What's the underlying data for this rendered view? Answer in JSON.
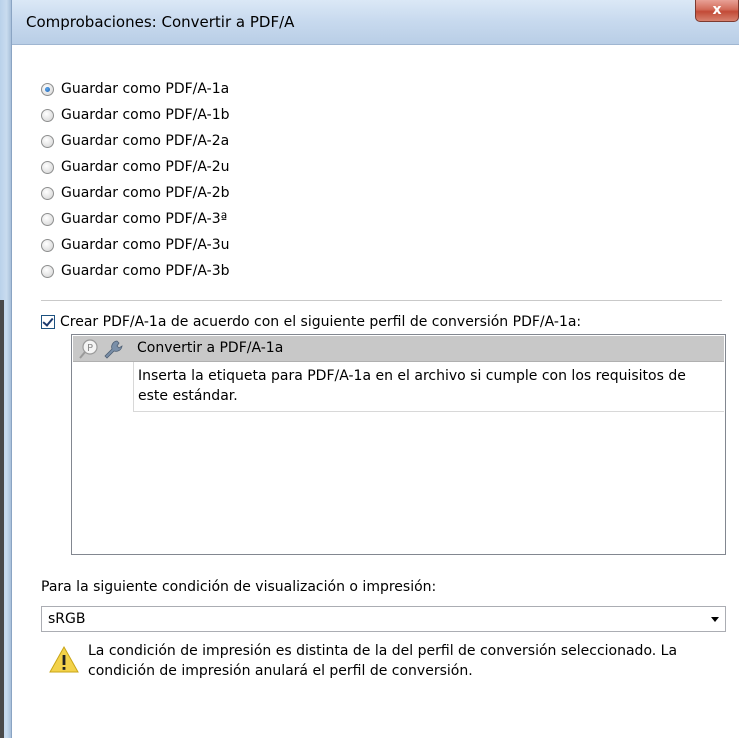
{
  "window": {
    "title": "Comprobaciones: Convertir a PDF/A",
    "close_label": "x"
  },
  "options": [
    {
      "label": "Guardar como PDF/A-1a",
      "checked": true
    },
    {
      "label": "Guardar como PDF/A-1b",
      "checked": false
    },
    {
      "label": "Guardar como PDF/A-2a",
      "checked": false
    },
    {
      "label": "Guardar como PDF/A-2u",
      "checked": false
    },
    {
      "label": "Guardar como PDF/A-2b",
      "checked": false
    },
    {
      "label": "Guardar como PDF/A-3ª",
      "checked": false
    },
    {
      "label": "Guardar como PDF/A-3u",
      "checked": false
    },
    {
      "label": "Guardar como PDF/A-3b",
      "checked": false
    }
  ],
  "create_checkbox": {
    "label": "Crear PDF/A-1a de acuerdo con el siguiente perfil de conversión PDF/A-1a:",
    "checked": true
  },
  "profile": {
    "name": "Convertir a PDF/A-1a",
    "description": "Inserta la etiqueta para PDF/A-1a en el archivo si cumple con los requisitos de este estándar.",
    "icons": [
      "magnifier-profile-icon",
      "wrench-icon"
    ]
  },
  "condition": {
    "label": "Para la siguiente condición de visualización o impresión:",
    "selected": "sRGB"
  },
  "warning": {
    "icon": "warning-icon",
    "text": "La condición de impresión es distinta de la del perfil de conversión seleccionado. La condición de impresión anulará el perfil de conversión."
  }
}
